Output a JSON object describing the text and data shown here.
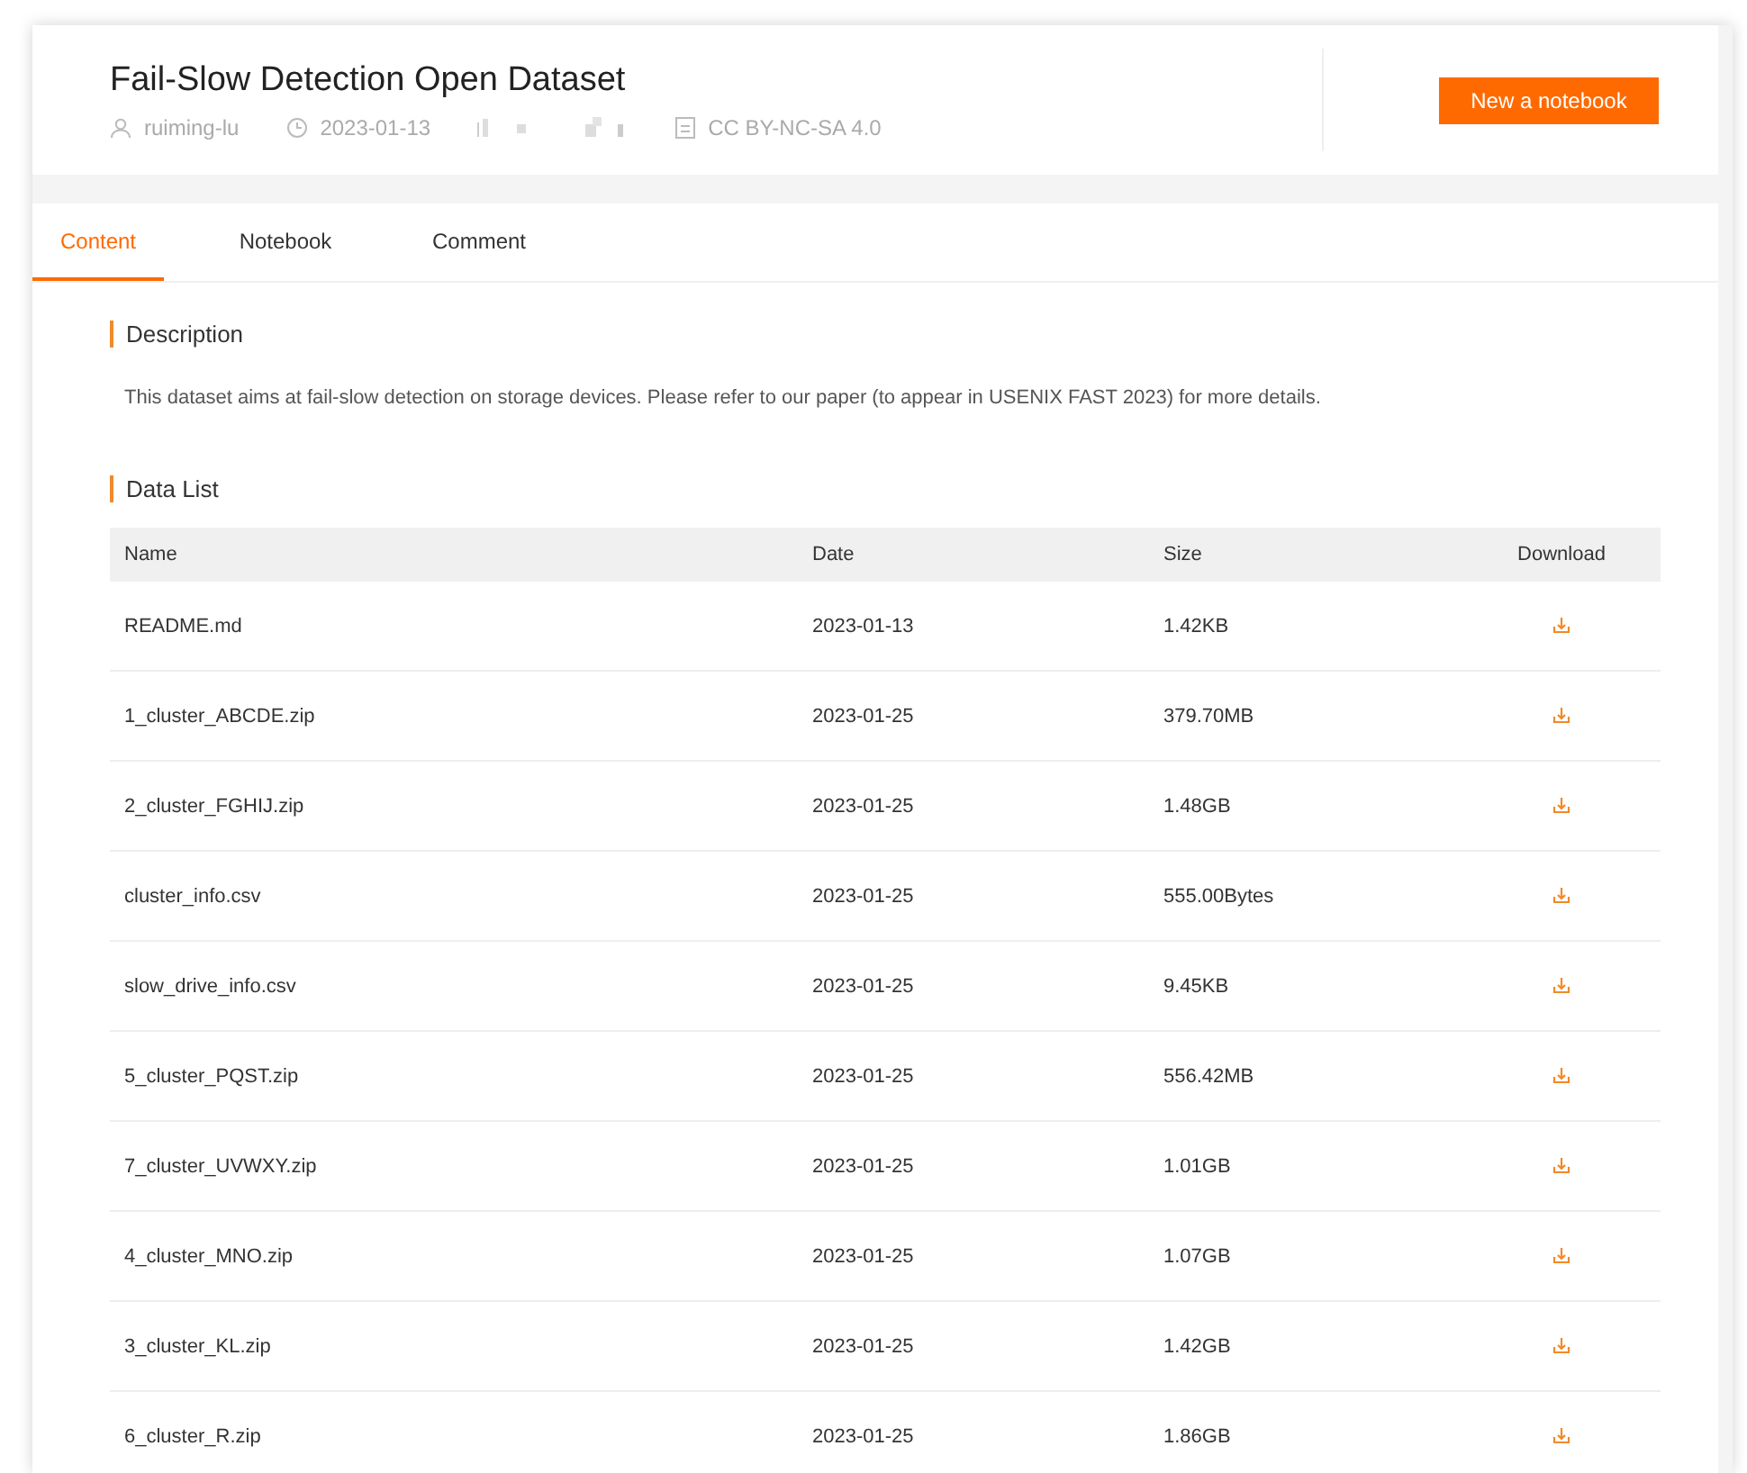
{
  "header": {
    "title": "Fail-Slow Detection Open Dataset",
    "author": "ruiming-lu",
    "date": "2023-01-13",
    "license": "CC BY-NC-SA 4.0",
    "button": "New a notebook"
  },
  "tabs": [
    {
      "label": "Content",
      "selected": true
    },
    {
      "label": "Notebook",
      "selected": false
    },
    {
      "label": "Comment",
      "selected": false
    }
  ],
  "description": {
    "heading": "Description",
    "text": "This dataset aims at fail-slow detection on storage devices. Please refer to our paper (to appear in USENIX FAST 2023) for more details."
  },
  "data_list": {
    "heading": "Data List",
    "columns": [
      "Name",
      "Date",
      "Size",
      "Download"
    ],
    "rows": [
      {
        "name": "README.md",
        "date": "2023-01-13",
        "size": "1.42KB"
      },
      {
        "name": "1_cluster_ABCDE.zip",
        "date": "2023-01-25",
        "size": "379.70MB"
      },
      {
        "name": "2_cluster_FGHIJ.zip",
        "date": "2023-01-25",
        "size": "1.48GB"
      },
      {
        "name": "cluster_info.csv",
        "date": "2023-01-25",
        "size": "555.00Bytes"
      },
      {
        "name": "slow_drive_info.csv",
        "date": "2023-01-25",
        "size": "9.45KB"
      },
      {
        "name": "5_cluster_PQST.zip",
        "date": "2023-01-25",
        "size": "556.42MB"
      },
      {
        "name": "7_cluster_UVWXY.zip",
        "date": "2023-01-25",
        "size": "1.01GB"
      },
      {
        "name": "4_cluster_MNO.zip",
        "date": "2023-01-25",
        "size": "1.07GB"
      },
      {
        "name": "3_cluster_KL.zip",
        "date": "2023-01-25",
        "size": "1.42GB"
      },
      {
        "name": "6_cluster_R.zip",
        "date": "2023-01-25",
        "size": "1.86GB"
      }
    ]
  }
}
